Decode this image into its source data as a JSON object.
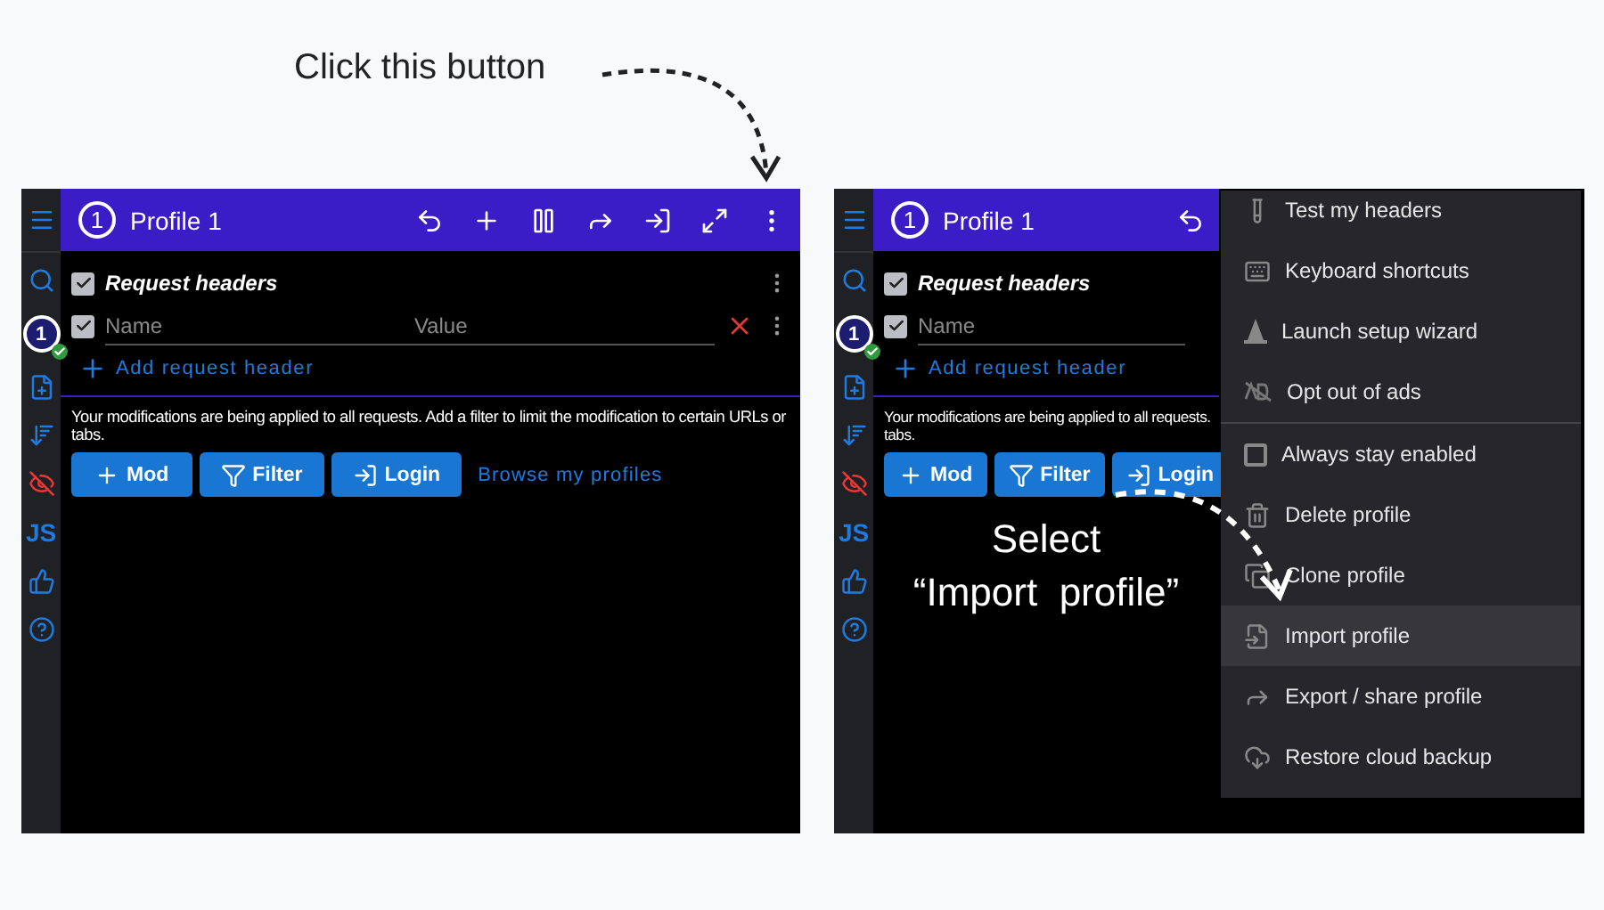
{
  "caption": {
    "text": "Click this button"
  },
  "panels": [
    {
      "header": {
        "badge": "1",
        "title": "Profile 1",
        "toolbar": [
          {
            "kind": "undo"
          },
          {
            "kind": "add"
          },
          {
            "kind": "pause"
          },
          {
            "kind": "forward"
          },
          {
            "kind": "login"
          },
          {
            "kind": "expand"
          },
          {
            "kind": "more"
          }
        ]
      },
      "sidebar": {
        "badge": "1",
        "js_label": "JS"
      },
      "group": {
        "title": "Request headers",
        "checked": true,
        "more_icon": true
      },
      "header_row": {
        "checked": true,
        "name_placeholder": "Name",
        "value_placeholder": "Value",
        "delete_icon": true,
        "more_icon": true
      },
      "add_link": "Add request header",
      "notice": [
        "Your modifications are being applied to all requests. Add a filter to limit the modification to certain URLs or",
        "tabs."
      ],
      "buttons": [
        {
          "kind": "mod",
          "label": "Mod"
        },
        {
          "kind": "filter",
          "label": "Filter"
        },
        {
          "kind": "login",
          "label": "Login"
        }
      ],
      "browse_link": "Browse my profiles"
    },
    {
      "header": {
        "badge": "1",
        "title": "Profile 1",
        "toolbar": [
          {
            "kind": "undo"
          }
        ]
      },
      "sidebar": {
        "badge": "1",
        "js_label": "JS"
      },
      "group": {
        "title": "Request headers",
        "checked": true,
        "more_icon": false
      },
      "header_row": {
        "checked": true,
        "name_placeholder": "Name",
        "delete_icon": false,
        "more_icon": false
      },
      "add_link": "Add request header",
      "notice": [
        "Your modifications are being applied to all requests.",
        "tabs."
      ],
      "buttons": [
        {
          "kind": "mod",
          "label": "Mod"
        },
        {
          "kind": "filter",
          "label": "Filter"
        },
        {
          "kind": "login",
          "label": "Login"
        }
      ]
    }
  ],
  "menu": {
    "sections": [
      {
        "items": [
          {
            "kind": "action",
            "label": "Test my headers",
            "selected": false
          },
          {
            "kind": "action",
            "label": "Keyboard shortcuts",
            "selected": false
          },
          {
            "kind": "action",
            "label": "Launch setup wizard",
            "selected": false
          },
          {
            "kind": "action",
            "label": "Opt out of ads",
            "selected": false
          }
        ]
      },
      {
        "items": [
          {
            "kind": "checkbox",
            "label": "Always stay enabled",
            "checked": false,
            "selected": false
          },
          {
            "kind": "action",
            "label": "Delete profile",
            "selected": false
          },
          {
            "kind": "action",
            "label": "Clone profile",
            "selected": false
          },
          {
            "kind": "action",
            "label": "Import profile",
            "selected": true
          },
          {
            "kind": "action",
            "label": "Export / share profile",
            "selected": false
          },
          {
            "kind": "action",
            "label": "Restore cloud backup",
            "selected": false
          }
        ]
      }
    ]
  },
  "callout": {
    "lines": [
      "Select",
      "“Import  profile”"
    ]
  }
}
